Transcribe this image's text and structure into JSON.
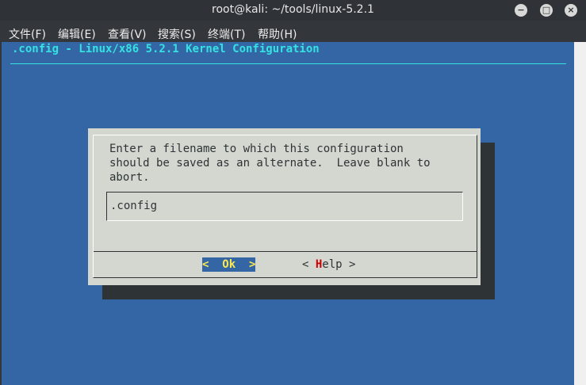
{
  "window": {
    "title": "root@kali: ~/tools/linux-5.2.1",
    "minimize": "−",
    "maximize": "□",
    "close": "×"
  },
  "menu": [
    {
      "label": "文件(F)"
    },
    {
      "label": "编辑(E)"
    },
    {
      "label": "查看(V)"
    },
    {
      "label": "搜索(S)"
    },
    {
      "label": "终端(T)"
    },
    {
      "label": "帮助(H)"
    }
  ],
  "terminal": {
    "backtitle": ".config - Linux/x86 5.2.1 Kernel Configuration",
    "dialog": {
      "message_lines": [
        "Enter a filename to which this configuration",
        "should be saved as an alternate.  Leave blank to",
        "abort."
      ],
      "input_value": ".config",
      "ok_button": "<  Ok  >",
      "help_prefix": "< ",
      "help_hot": "H",
      "help_rest": "elp >"
    }
  },
  "colors": {
    "terminal_bg": "#3465a4",
    "title_text": "#34e2e2",
    "dialog_bg": "#d3d7cf",
    "selected_button_bg": "#3465a4",
    "selected_button_text": "#fce94f",
    "hotkey": "#cc0000"
  }
}
